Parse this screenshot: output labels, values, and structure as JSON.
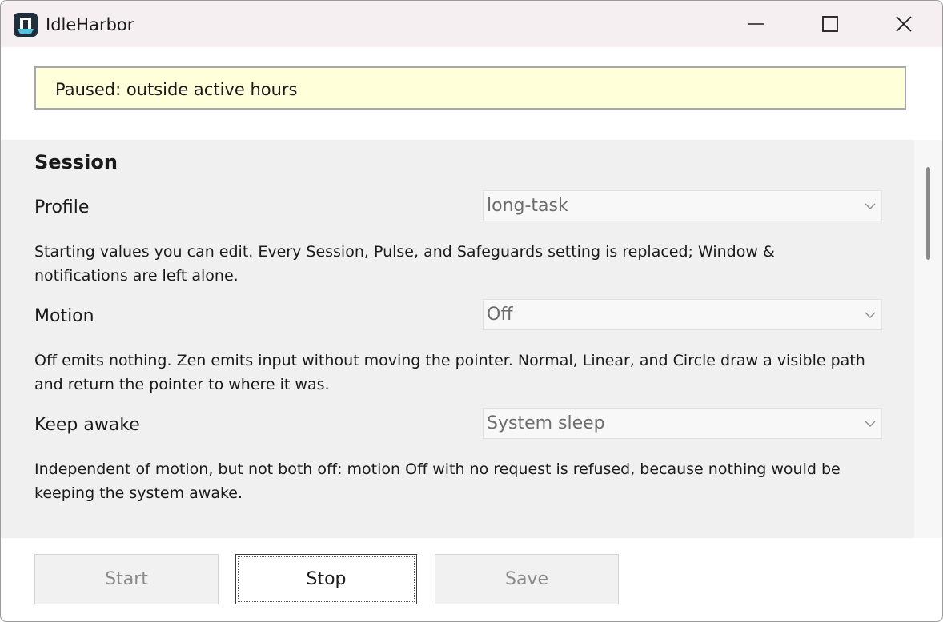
{
  "window": {
    "title": "IdleHarbor",
    "app_icon": "idleharbor-logo-icon",
    "controls": [
      "minimize-icon",
      "maximize-icon",
      "close-icon"
    ]
  },
  "status": {
    "text": "Paused: outside active hours",
    "background": "#ffffd9"
  },
  "session": {
    "title": "Session",
    "profile": {
      "label": "Profile",
      "value": "long-task",
      "help": "Starting values you can edit. Every Session, Pulse, and Safeguards setting is replaced; Window & notifications are left alone."
    },
    "motion": {
      "label": "Motion",
      "value": "Off",
      "help": "Off emits nothing. Zen emits input without moving the pointer. Normal, Linear, and Circle draw a visible path and return the pointer to where it was."
    },
    "keep_awake": {
      "label": "Keep awake",
      "value": "System sleep",
      "help": "Independent of motion, but not both off: motion Off with no request is refused, because nothing would be keeping the system awake."
    }
  },
  "buttons": {
    "start": "Start",
    "stop": "Stop",
    "save": "Save"
  }
}
